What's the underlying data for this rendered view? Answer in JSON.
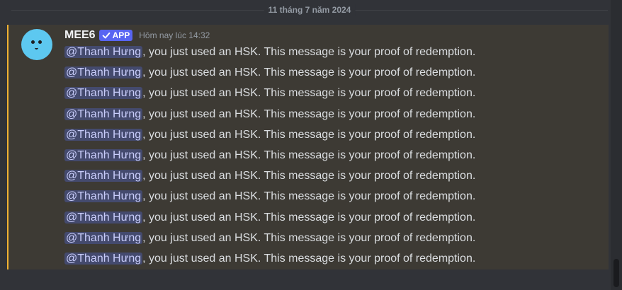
{
  "date_divider": "11 tháng 7 năm 2024",
  "message": {
    "author": "MEE6",
    "badge": "APP",
    "timestamp": "Hôm nay lúc 14:32",
    "lines": [
      {
        "mention": "@Thanh Hưng",
        "text": ", you just used an HSK. This message is your proof of redemption."
      },
      {
        "mention": "@Thanh Hưng",
        "text": ", you just used an HSK. This message is your proof of redemption."
      },
      {
        "mention": "@Thanh Hưng",
        "text": ", you just used an HSK. This message is your proof of redemption."
      },
      {
        "mention": "@Thanh Hưng",
        "text": ", you just used an HSK. This message is your proof of redemption."
      },
      {
        "mention": "@Thanh Hưng",
        "text": ", you just used an HSK. This message is your proof of redemption."
      },
      {
        "mention": "@Thanh Hưng",
        "text": ", you just used an HSK. This message is your proof of redemption."
      },
      {
        "mention": "@Thanh Hưng",
        "text": ", you just used an HSK. This message is your proof of redemption."
      },
      {
        "mention": "@Thanh Hưng",
        "text": ", you just used an HSK. This message is your proof of redemption."
      },
      {
        "mention": "@Thanh Hưng",
        "text": ", you just used an HSK. This message is your proof of redemption."
      },
      {
        "mention": "@Thanh Hưng",
        "text": ", you just used an HSK. This message is your proof of redemption."
      },
      {
        "mention": "@Thanh Hưng",
        "text": ", you just used an HSK. This message is your proof of redemption."
      }
    ]
  },
  "icons": {
    "avatar": "mee6-avatar",
    "badge_check": "checkmark-icon"
  },
  "colors": {
    "background": "#313338",
    "highlight_background": "#3d3a34",
    "highlight_border": "#f0b232",
    "badge": "#5865f2",
    "mention_background": "#444a6e",
    "mention_text": "#c9cdfb",
    "avatar": "#5dc8f0"
  }
}
